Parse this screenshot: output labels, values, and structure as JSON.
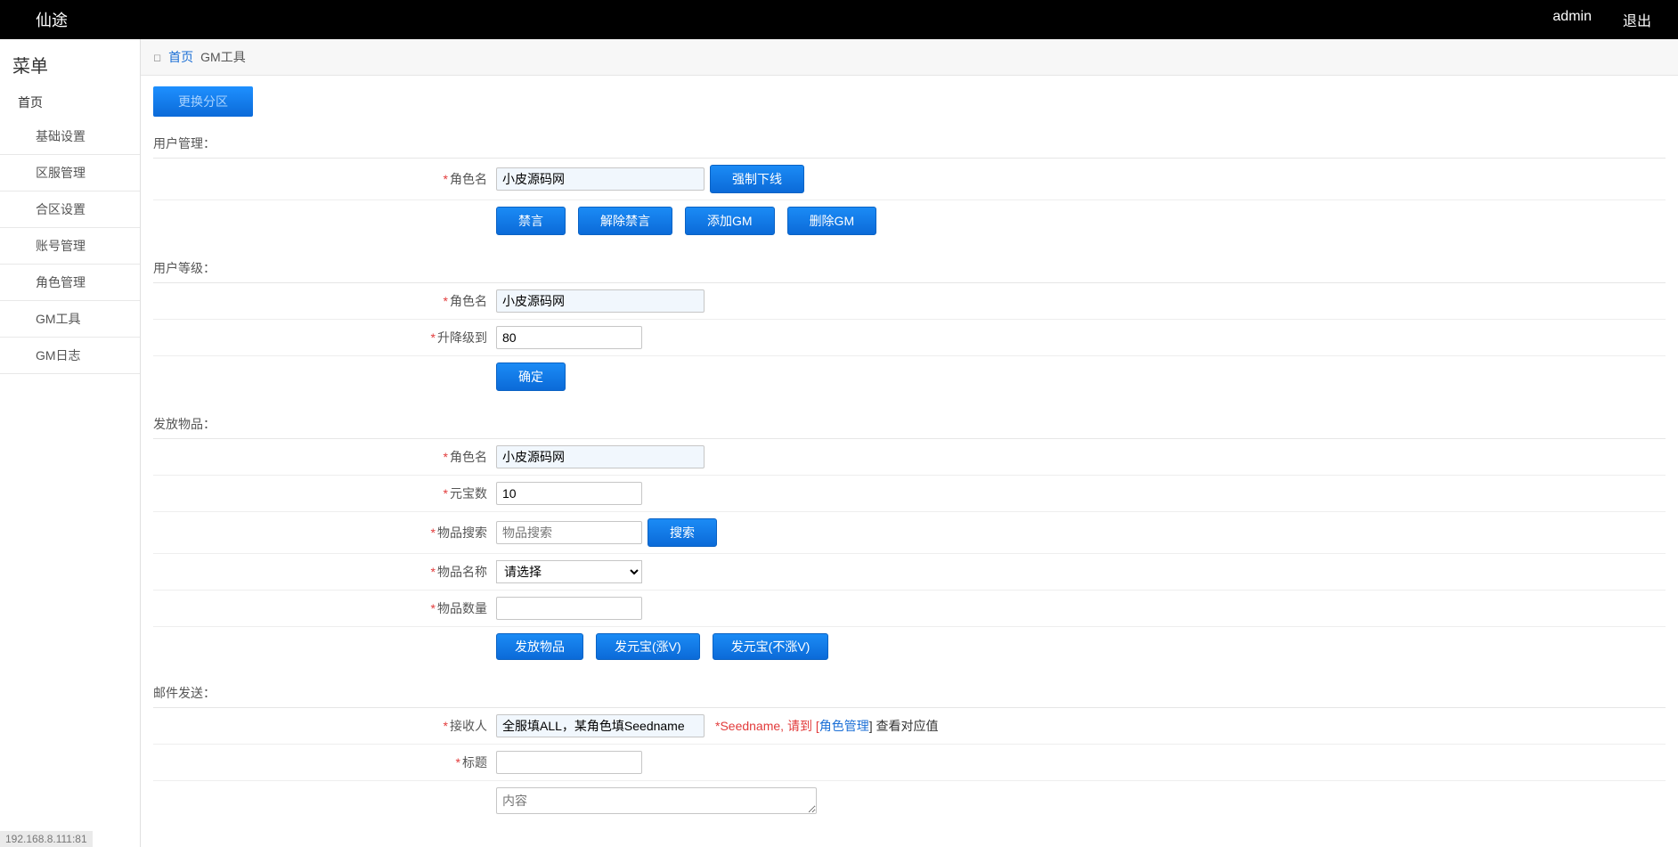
{
  "topbar": {
    "title": "仙途",
    "user": "admin",
    "logout": "退出"
  },
  "sidebar": {
    "title": "菜单",
    "home": "首页",
    "items": [
      "基础设置",
      "区服管理",
      "合区设置",
      "账号管理",
      "角色管理",
      "GM工具",
      "GM日志"
    ]
  },
  "breadcrumb": {
    "home": "首页",
    "current": "GM工具"
  },
  "switchZone": "更换分区",
  "sections": {
    "userMgmt": {
      "title": "用户管理：",
      "roleLabel": "角色名",
      "roleValue": "小皮源码网",
      "forceOffline": "强制下线",
      "btns": [
        "禁言",
        "解除禁言",
        "添加GM",
        "删除GM"
      ]
    },
    "userLevel": {
      "title": "用户等级：",
      "roleLabel": "角色名",
      "roleValue": "小皮源码网",
      "levelLabel": "升降级到",
      "levelValue": "80",
      "confirm": "确定"
    },
    "giveItem": {
      "title": "发放物品：",
      "roleLabel": "角色名",
      "roleValue": "小皮源码网",
      "goldLabel": "元宝数",
      "goldValue": "10",
      "searchLabel": "物品搜索",
      "searchPlaceholder": "物品搜索",
      "searchBtn": "搜索",
      "itemNameLabel": "物品名称",
      "itemSelectPlaceholder": "请选择",
      "itemCountLabel": "物品数量",
      "btns": [
        "发放物品",
        "发元宝(涨V)",
        "发元宝(不涨V)"
      ]
    },
    "mail": {
      "title": "邮件发送：",
      "recipientLabel": "接收人",
      "recipientValue": "全服填ALL，某角色填Seedname",
      "hintPrefix": "*Seedname, 请到 [",
      "hintLink": "角色管理",
      "hintSuffix": "] 查看对应值",
      "titleLabel": "标题",
      "contentPlaceholder": "内容"
    }
  },
  "statusBar": "192.168.8.111:81"
}
